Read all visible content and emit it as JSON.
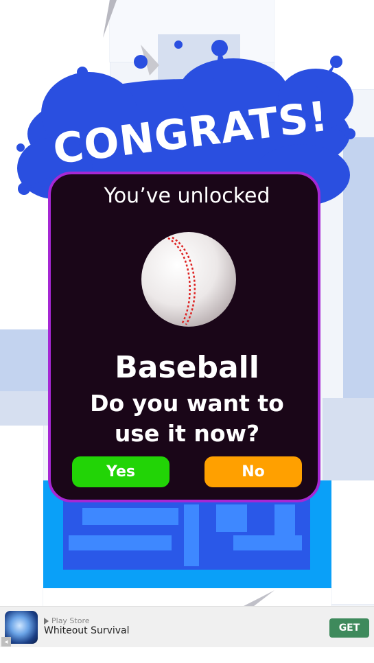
{
  "popup": {
    "banner_text": "CONGRATS!",
    "unlock_text": "You’ve unlocked",
    "item_name": "Baseball",
    "question_line1": "Do you want to",
    "question_line2": "use it now?",
    "yes_label": "Yes",
    "no_label": "No",
    "item_icon": "baseball-icon"
  },
  "ad": {
    "store_label": "Play Store",
    "app_name": "Whiteout Survival",
    "cta_label": "GET",
    "info_glyph": "◂"
  },
  "colors": {
    "splat_blue": "#2a4fe0",
    "dialog_bg": "#1a0618",
    "dialog_border": "#a628d4",
    "yes_green": "#22d406",
    "no_orange": "#ffa000",
    "get_green": "#3e8a5c"
  }
}
